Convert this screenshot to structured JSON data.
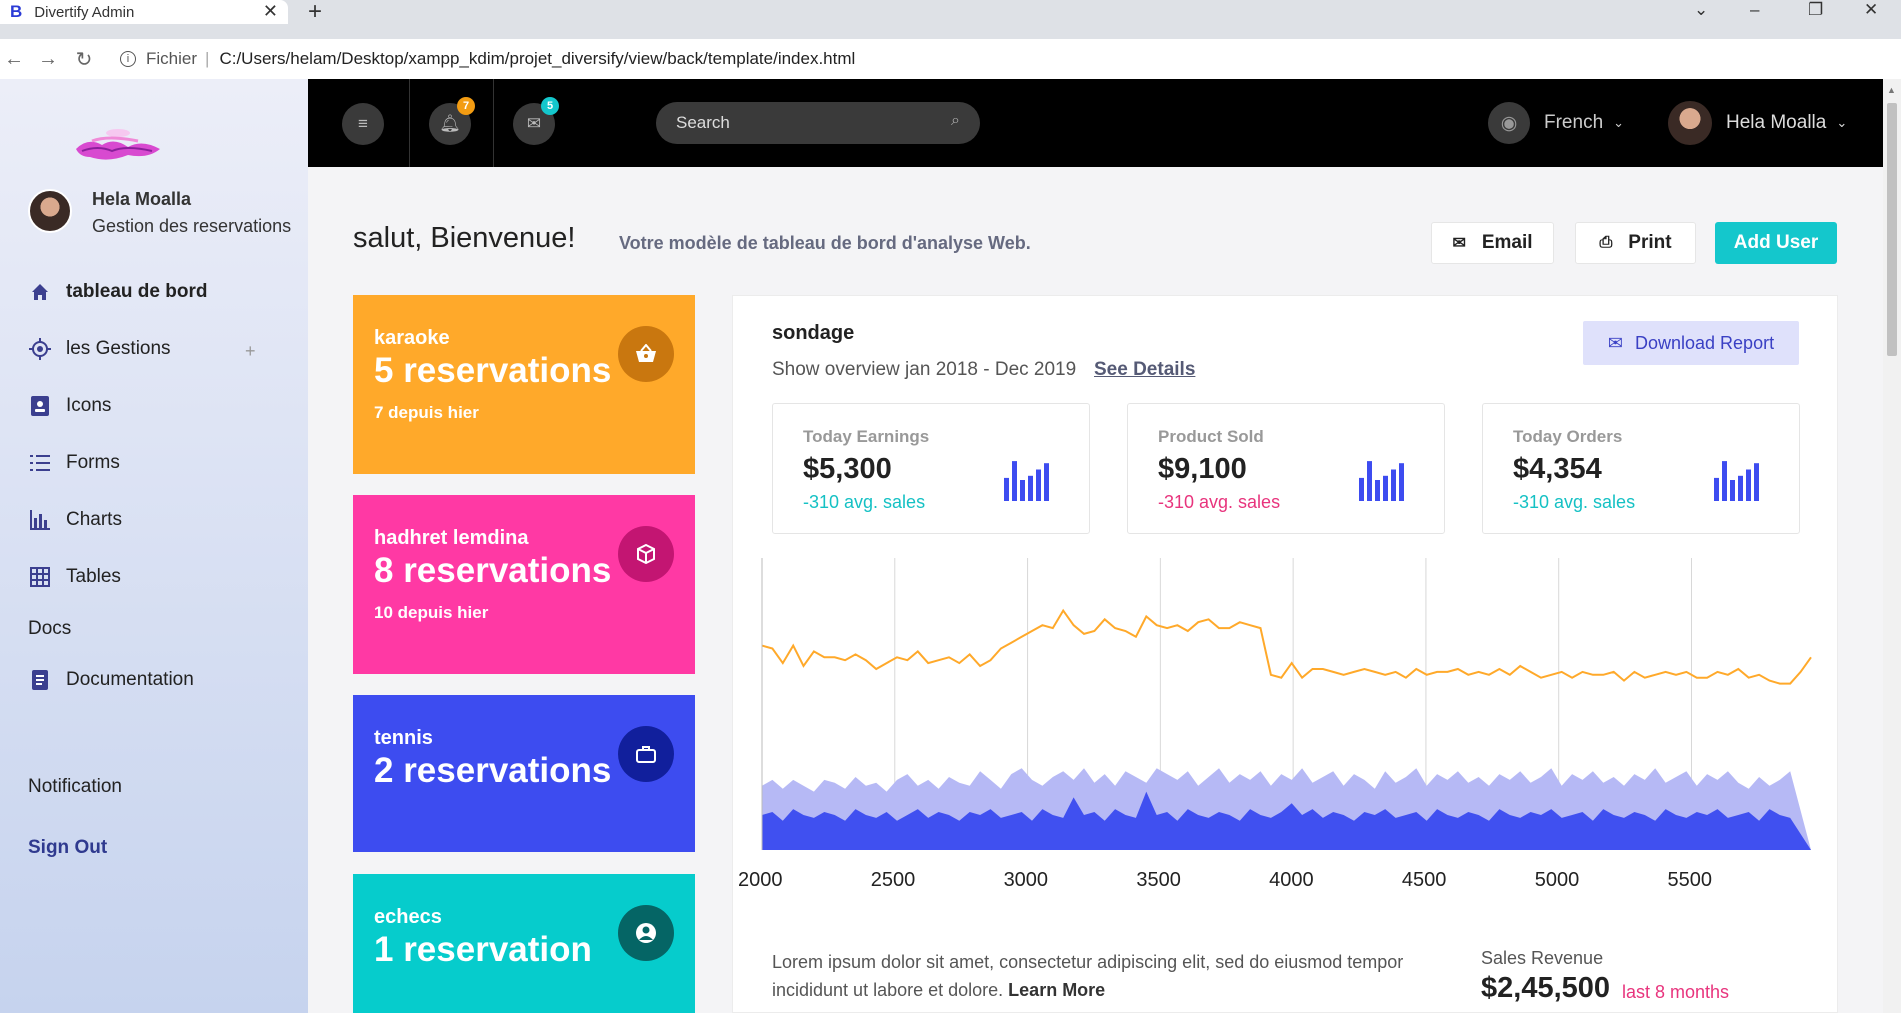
{
  "browser": {
    "tab_title": "Divertify Admin",
    "tab_favicon": "B",
    "scheme_label": "Fichier",
    "url": "C:/Users/helam/Desktop/xampp_kdim/projet_diversify/view/back/template/index.html"
  },
  "sidebar": {
    "user_name": "Hela Moalla",
    "user_role": "Gestion des reservations",
    "items": [
      {
        "label": "tableau de bord",
        "icon": "home-icon"
      },
      {
        "label": "les Gestions",
        "icon": "target-icon"
      },
      {
        "label": "Icons",
        "icon": "contact-card-icon"
      },
      {
        "label": "Forms",
        "icon": "list-icon"
      },
      {
        "label": "Charts",
        "icon": "bar-chart-icon"
      },
      {
        "label": "Tables",
        "icon": "table-icon"
      }
    ],
    "section_docs": "Docs",
    "documentation": "Documentation",
    "notification": "Notification",
    "signout": "Sign Out"
  },
  "topbar": {
    "notif_count": "7",
    "mail_count": "5",
    "search_placeholder": "Search",
    "language": "French",
    "user_name": "Hela Moalla"
  },
  "header": {
    "greeting": "salut, Bienvenue!",
    "subtitle": "Votre modèle de tableau de bord d'analyse Web.",
    "email_btn": "Email",
    "print_btn": "Print",
    "add_user_btn": "Add User"
  },
  "cards": [
    {
      "title": "karaoke",
      "count": "5 reservations",
      "delta": "7 depuis hier",
      "color": "#ffa92a",
      "circle": "#c9770f",
      "icon": "basket-icon"
    },
    {
      "title": "hadhret lemdina",
      "count": "8 reservations",
      "delta": "10 depuis hier",
      "color": "#ff39a4",
      "circle": "#c31572",
      "icon": "cube-icon"
    },
    {
      "title": "tennis",
      "count": "2 reservations",
      "delta": "",
      "color": "#3d4cf0",
      "circle": "#111f9c",
      "icon": "briefcase-icon"
    },
    {
      "title": "echecs",
      "count": "1 reservation",
      "delta": "",
      "color": "#06cccc",
      "circle": "#056565",
      "icon": "user-circle-icon"
    }
  ],
  "panel": {
    "title": "sondage",
    "overview": "Show overview jan 2018 - Dec 2019",
    "see_details": "See Details",
    "download": "Download Report",
    "stats": [
      {
        "label": "Today Earnings",
        "value": "$5,300",
        "sub": "-310 avg. sales",
        "sub_color": "#15c1c4"
      },
      {
        "label": "Product Sold",
        "value": "$9,100",
        "sub": "-310 avg. sales",
        "sub_color": "#e8347d"
      },
      {
        "label": "Today Orders",
        "value": "$4,354",
        "sub": "-310 avg. sales",
        "sub_color": "#15c1c4"
      }
    ],
    "footer_text": "Lorem ipsum dolor sit amet, consectetur adipiscing elit, sed do eiusmod tempor incididunt ut labore et dolore.",
    "learn_more": "Learn More",
    "revenue_label": "Sales Revenue",
    "revenue_value": "$2,45,500",
    "revenue_sub": "last 8 months"
  },
  "chart_data": {
    "type": "line",
    "x_ticks": [
      2000,
      2500,
      3000,
      3500,
      4000,
      4500,
      5000,
      5500
    ],
    "xlim": [
      2000,
      5950
    ],
    "series": [
      {
        "color": "#ffa92a",
        "type": "line",
        "values": [
          70,
          69,
          64,
          70,
          63,
          68,
          66,
          66,
          65,
          67,
          65,
          62,
          64,
          66,
          65,
          68,
          64,
          65,
          66,
          64,
          67,
          63,
          65,
          69,
          71,
          73,
          75,
          77,
          76,
          82,
          77,
          74,
          75,
          79,
          76,
          75,
          73,
          80,
          77,
          76,
          77,
          75,
          78,
          79,
          76,
          76,
          78,
          77,
          76,
          60,
          59,
          64,
          59,
          62,
          62,
          61,
          60,
          61,
          62,
          61,
          60,
          61,
          59,
          62,
          60,
          61,
          61,
          62,
          60,
          61,
          60,
          62,
          60,
          63,
          61,
          59,
          60,
          61,
          59,
          61,
          60,
          60,
          61,
          58,
          61,
          59,
          60,
          61,
          60,
          61,
          59,
          59,
          61,
          60,
          62,
          59,
          60,
          58,
          57,
          57,
          61,
          66
        ]
      },
      {
        "color": "#b6b9f5",
        "type": "area",
        "values": [
          22,
          24,
          21,
          24,
          22,
          20,
          24,
          23,
          21,
          25,
          22,
          23,
          20,
          24,
          26,
          22,
          24,
          21,
          25,
          23,
          22,
          27,
          24,
          21,
          26,
          28,
          24,
          22,
          25,
          27,
          24,
          28,
          23,
          26,
          22,
          27,
          25,
          23,
          28,
          26,
          24,
          27,
          22,
          25,
          28,
          23,
          26,
          24,
          27,
          22,
          26,
          24,
          28,
          23,
          25,
          27,
          22,
          26,
          24,
          21,
          27,
          23,
          25,
          28,
          22,
          26,
          24,
          27,
          23,
          25,
          22,
          26,
          24,
          27,
          23,
          25,
          28,
          22,
          26,
          24,
          27,
          23,
          25,
          22,
          26,
          24,
          28,
          23,
          25,
          27,
          22,
          26,
          24,
          27,
          23,
          21,
          25,
          22,
          24,
          27
        ]
      },
      {
        "color": "#4050f0",
        "type": "area",
        "values": [
          12,
          13,
          10,
          14,
          12,
          11,
          13,
          12,
          10,
          14,
          12,
          11,
          13,
          10,
          12,
          14,
          11,
          13,
          12,
          10,
          13,
          12,
          14,
          11,
          12,
          13,
          10,
          14,
          12,
          11,
          18,
          12,
          13,
          10,
          14,
          12,
          11,
          20,
          12,
          13,
          10,
          14,
          12,
          11,
          13,
          12,
          10,
          14,
          12,
          11,
          13,
          16,
          12,
          14,
          11,
          13,
          12,
          10,
          13,
          12,
          14,
          11,
          12,
          13,
          10,
          14,
          12,
          11,
          13,
          12,
          10,
          14,
          12,
          11,
          13,
          12,
          14,
          11,
          12,
          13,
          10,
          14,
          12,
          11,
          13,
          12,
          10,
          14,
          12,
          11,
          13,
          12,
          14,
          11,
          12,
          13,
          10,
          14,
          12,
          11
        ]
      }
    ],
    "ylim": [
      0,
      100
    ]
  }
}
